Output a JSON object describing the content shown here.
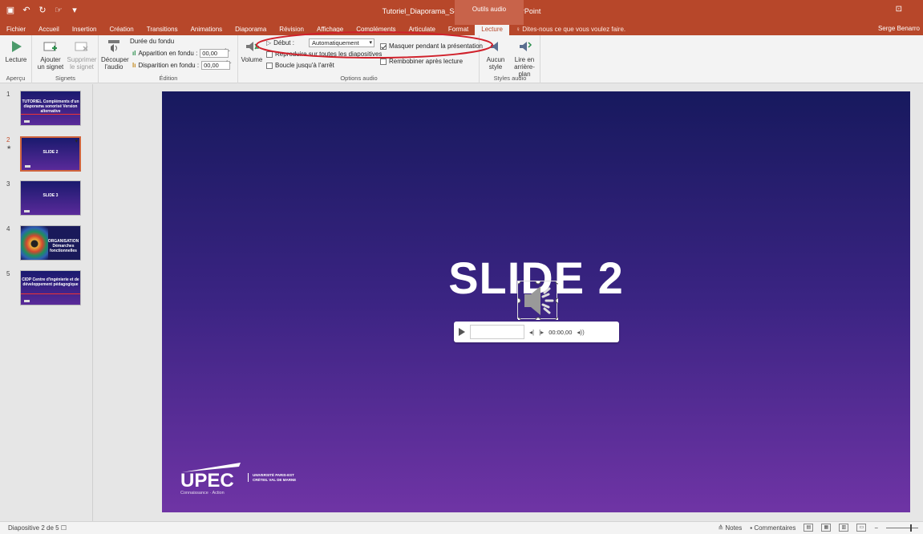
{
  "titlebar": {
    "document_title": "Tutoriel_Diaporama_Sonorise2.pptx - PowerPoint",
    "context_tab": "Outils audio"
  },
  "tabs": [
    {
      "label": "Fichier"
    },
    {
      "label": "Accueil"
    },
    {
      "label": "Insertion"
    },
    {
      "label": "Création"
    },
    {
      "label": "Transitions"
    },
    {
      "label": "Animations"
    },
    {
      "label": "Diaporama"
    },
    {
      "label": "Révision"
    },
    {
      "label": "Affichage"
    },
    {
      "label": "Compléments"
    },
    {
      "label": "Articulate"
    },
    {
      "label": "Format"
    },
    {
      "label": "Lecture",
      "active": true
    }
  ],
  "tell_me": "Dites-nous ce que vous voulez faire.",
  "user": "Serge Benarro",
  "ribbon": {
    "apercu": {
      "btn": "Lecture",
      "group": "Aperçu"
    },
    "signets": {
      "add": "Ajouter un signet",
      "remove": "Supprimer le signet",
      "group": "Signets"
    },
    "edition": {
      "cut": "Découper l'audio",
      "fade_title": "Durée du fondu",
      "fade_in_label": "Apparition en fondu :",
      "fade_in_value": "00,00",
      "fade_out_label": "Disparition en fondu :",
      "fade_out_value": "00,00",
      "group": "Édition"
    },
    "options": {
      "volume": "Volume",
      "start_label": "Début :",
      "start_value": "Automatiquement",
      "hide": "Masquer pendant la présentation",
      "play_all": "Reproduire sur toutes les diapositives",
      "loop": "Boucle jusqu'à l'arrêt",
      "rewind": "Rembobiner après lecture",
      "group": "Options audio"
    },
    "styles": {
      "none": "Aucun style",
      "background": "Lire en arrière-plan",
      "group": "Styles audio"
    }
  },
  "slides": [
    {
      "num": "1",
      "title": "TUTORIEL Compléments d'un diaporama sonorisé Version alternative"
    },
    {
      "num": "2",
      "title": "SLIDE 2",
      "selected": true
    },
    {
      "num": "3",
      "title": "SLIDE 3"
    },
    {
      "num": "4",
      "title": "ORGANISATION Démarches fonctionnelles"
    },
    {
      "num": "5",
      "title": "CIDP Centre d'ingénierie et de développement pédagogique"
    }
  ],
  "slide": {
    "title": "SLIDE 2",
    "logo": "UPEC",
    "logo_sub": "Connaissance · Action",
    "logo_uni": "UNIVERSITÉ PARIS-EST CRÉTEIL VAL DE MARNE"
  },
  "player": {
    "time": "00:00,00"
  },
  "status": {
    "slide_info": "Diapositive 2 de 5",
    "notes": "Notes",
    "comments": "Commentaires"
  },
  "colors": {
    "accent": "#b7472a",
    "slide_top": "#17195e",
    "slide_bottom": "#6f34a5"
  }
}
